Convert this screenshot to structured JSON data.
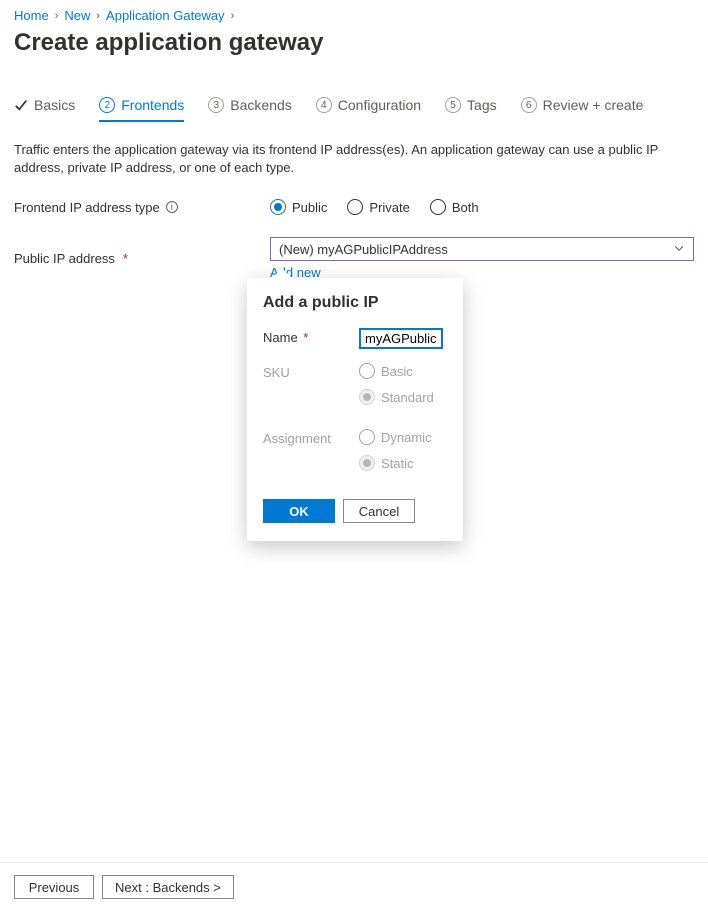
{
  "breadcrumb": [
    {
      "label": "Home"
    },
    {
      "label": "New"
    },
    {
      "label": "Application Gateway"
    }
  ],
  "page_title": "Create application gateway",
  "tabs": [
    {
      "index": "1",
      "label": "Basics",
      "state": "completed"
    },
    {
      "index": "2",
      "label": "Frontends",
      "state": "active"
    },
    {
      "index": "3",
      "label": "Backends",
      "state": "upcoming"
    },
    {
      "index": "4",
      "label": "Configuration",
      "state": "upcoming"
    },
    {
      "index": "5",
      "label": "Tags",
      "state": "upcoming"
    },
    {
      "index": "6",
      "label": "Review + create",
      "state": "upcoming"
    }
  ],
  "description": "Traffic enters the application gateway via its frontend IP address(es). An application gateway can use a public IP address, private IP address, or one of each type.",
  "frontend_ip": {
    "label": "Frontend IP address type",
    "options": [
      {
        "label": "Public",
        "selected": true
      },
      {
        "label": "Private",
        "selected": false
      },
      {
        "label": "Both",
        "selected": false
      }
    ]
  },
  "public_ip": {
    "label": "Public IP address",
    "value": "(New) myAGPublicIPAddress",
    "add_new": "Add new"
  },
  "popup": {
    "title": "Add a public IP",
    "name_label": "Name",
    "name_value": "myAGPublicIPAddress",
    "sku_label": "SKU",
    "sku_options": [
      {
        "label": "Basic",
        "locked": false
      },
      {
        "label": "Standard",
        "locked": true
      }
    ],
    "assignment_label": "Assignment",
    "assignment_options": [
      {
        "label": "Dynamic",
        "locked": false
      },
      {
        "label": "Static",
        "locked": true
      }
    ],
    "ok": "OK",
    "cancel": "Cancel"
  },
  "footer": {
    "previous": "Previous",
    "next": "Next : Backends >"
  }
}
